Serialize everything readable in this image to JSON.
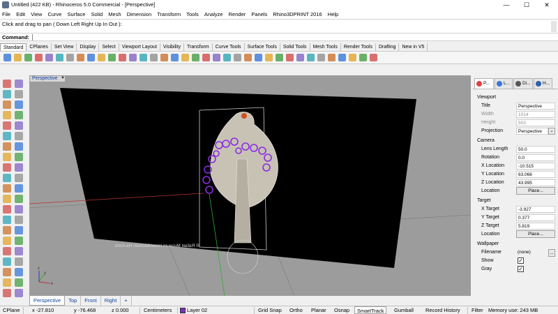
{
  "window": {
    "title": "Untitled (422 KB) - Rhinoceros 5.0 Commercial - [Perspective]",
    "minimize": "—",
    "maximize": "☐",
    "close": "✕"
  },
  "menu": [
    "File",
    "Edit",
    "View",
    "Curve",
    "Surface",
    "Solid",
    "Mesh",
    "Dimension",
    "Transform",
    "Tools",
    "Analyze",
    "Render",
    "Panels",
    "Rhino3DPRINT 2016",
    "Help"
  ],
  "command": {
    "history": "Click and drag to pan ( Down  Left  Right  Up  In  Out ):",
    "label": "Command:",
    "value": ""
  },
  "toolbar_tabs": [
    "Standard",
    "CPlanes",
    "Set View",
    "Display",
    "Select",
    "Viewport Layout",
    "Visibility",
    "Transform",
    "Curve Tools",
    "Surface Tools",
    "Solid Tools",
    "Mesh Tools",
    "Render Tools",
    "Drafting",
    "New in V5"
  ],
  "toolbar_icons": [
    "new-icon",
    "open-icon",
    "save-icon",
    "print-icon",
    "import-icon",
    "cut-icon",
    "copy-icon",
    "paste-icon",
    "undo-icon",
    "redo-icon",
    "pan-icon",
    "rotate-view-icon",
    "zoom-window-icon",
    "zoom-extents-icon",
    "zoom-all-icon",
    "zoom-selected-icon",
    "zoom-target-icon",
    "viewport-4-icon",
    "grid-icon",
    "points-on-icon",
    "points-off-icon",
    "cplane-icon",
    "hide-icon",
    "show-icon",
    "lock-icon",
    "light-icon",
    "layer-icon",
    "properties-icon",
    "render-icon",
    "material-icon",
    "sphere-icon",
    "environment-icon",
    "help-icon",
    "options-icon",
    "tools-icon",
    "script-icon"
  ],
  "viewport": {
    "name": "Perspective",
    "dropdown": "▼",
    "mirrored_text": "® Rafael Museum Israel/Muzeon Ha Arets",
    "axes": {
      "x": "x",
      "y": "y",
      "z": "z"
    }
  },
  "viewport_tabs": [
    "Perspective",
    "Top",
    "Front",
    "Right",
    "+"
  ],
  "panel": {
    "tabs": [
      "P...",
      "L...",
      "Di...",
      "H..."
    ],
    "viewport_section": "Viewport",
    "title_label": "Title",
    "title_value": "Perspective",
    "width_label": "Width",
    "width_value": "1014",
    "height_label": "Height",
    "height_value": "503",
    "projection_label": "Projection",
    "projection_value": "Perspective",
    "camera_section": "Camera",
    "lens_label": "Lens Length",
    "lens_value": "50.0",
    "rotation_label": "Rotation",
    "rotation_value": "0.0",
    "xloc_label": "X Location",
    "xloc_value": "-10.515",
    "yloc_label": "Y Location",
    "yloc_value": "63.066",
    "zloc_label": "Z Location",
    "zloc_value": "43.995",
    "location_label": "Location",
    "place_button": "Place...",
    "target_section": "Target",
    "xtarget_label": "X Target",
    "xtarget_value": "-3.927",
    "ytarget_label": "Y Target",
    "ytarget_value": "0.377",
    "ztarget_label": "Z Target",
    "ztarget_value": "5.819",
    "target_location_label": "Location",
    "target_place_button": "Place...",
    "wallpaper_section": "Wallpaper",
    "filename_label": "Filename",
    "filename_value": "(none)",
    "filename_button": "...",
    "show_label": "Show",
    "show_checked": "✓",
    "gray_label": "Gray",
    "gray_checked": "✓"
  },
  "status": {
    "cplane": "CPlane",
    "x": "x -27.810",
    "y": "y -76.468",
    "z": "z 0.000",
    "units": "Centimeters",
    "layer": "Layer 02",
    "layer_color": "#7b2fbe",
    "grid_snap": "Grid Snap",
    "ortho": "Ortho",
    "planar": "Planar",
    "osnap": "Osnap",
    "smarttrack": "SmartTrack",
    "gumball": "Gumball",
    "record_history": "Record History",
    "filter": "Filter",
    "memory": "Memory use: 243 MB"
  },
  "colors": {
    "accent": "#1040a0",
    "selection": "#8a2be2",
    "viewport_bg": "#9c9c9c",
    "wallpaper": "#000000"
  }
}
